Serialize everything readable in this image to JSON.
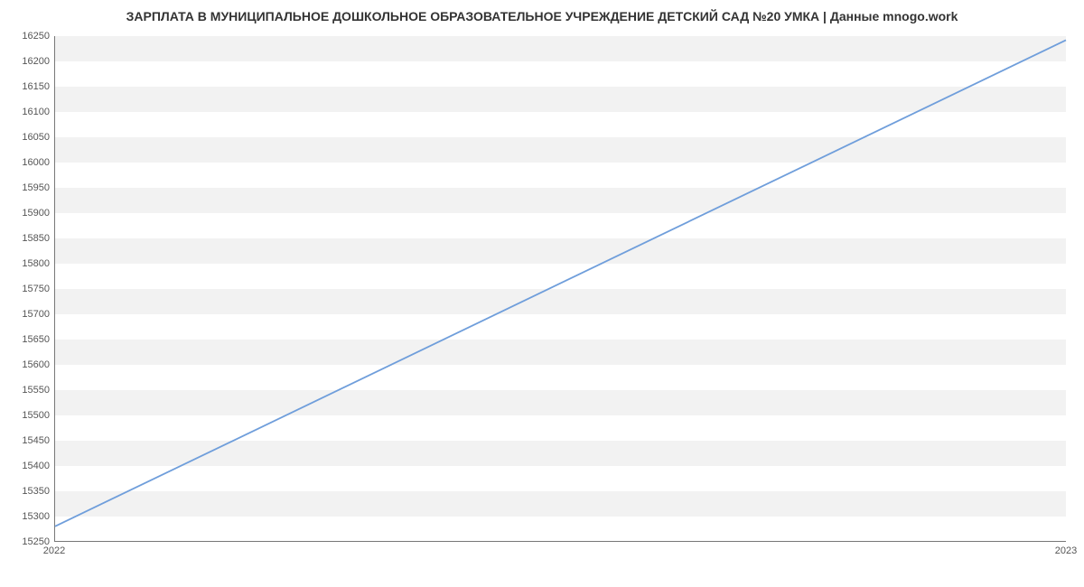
{
  "chart_data": {
    "type": "line",
    "title": "ЗАРПЛАТА В МУНИЦИПАЛЬНОЕ ДОШКОЛЬНОЕ ОБРАЗОВАТЕЛЬНОЕ УЧРЕЖДЕНИЕ ДЕТСКИЙ САД №20 УМКА | Данные mnogo.work",
    "x": [
      2022,
      2023
    ],
    "values": [
      15279,
      16242
    ],
    "xlabel": "",
    "ylabel": "",
    "xlim": [
      2022,
      2023
    ],
    "ylim": [
      15250,
      16250
    ],
    "yticks": [
      15250,
      15300,
      15350,
      15400,
      15450,
      15500,
      15550,
      15600,
      15650,
      15700,
      15750,
      15800,
      15850,
      15900,
      15950,
      16000,
      16050,
      16100,
      16150,
      16200,
      16250
    ],
    "xticks": [
      2022,
      2023
    ],
    "line_color": "#6f9edb",
    "band_color": "#f2f2f2"
  }
}
